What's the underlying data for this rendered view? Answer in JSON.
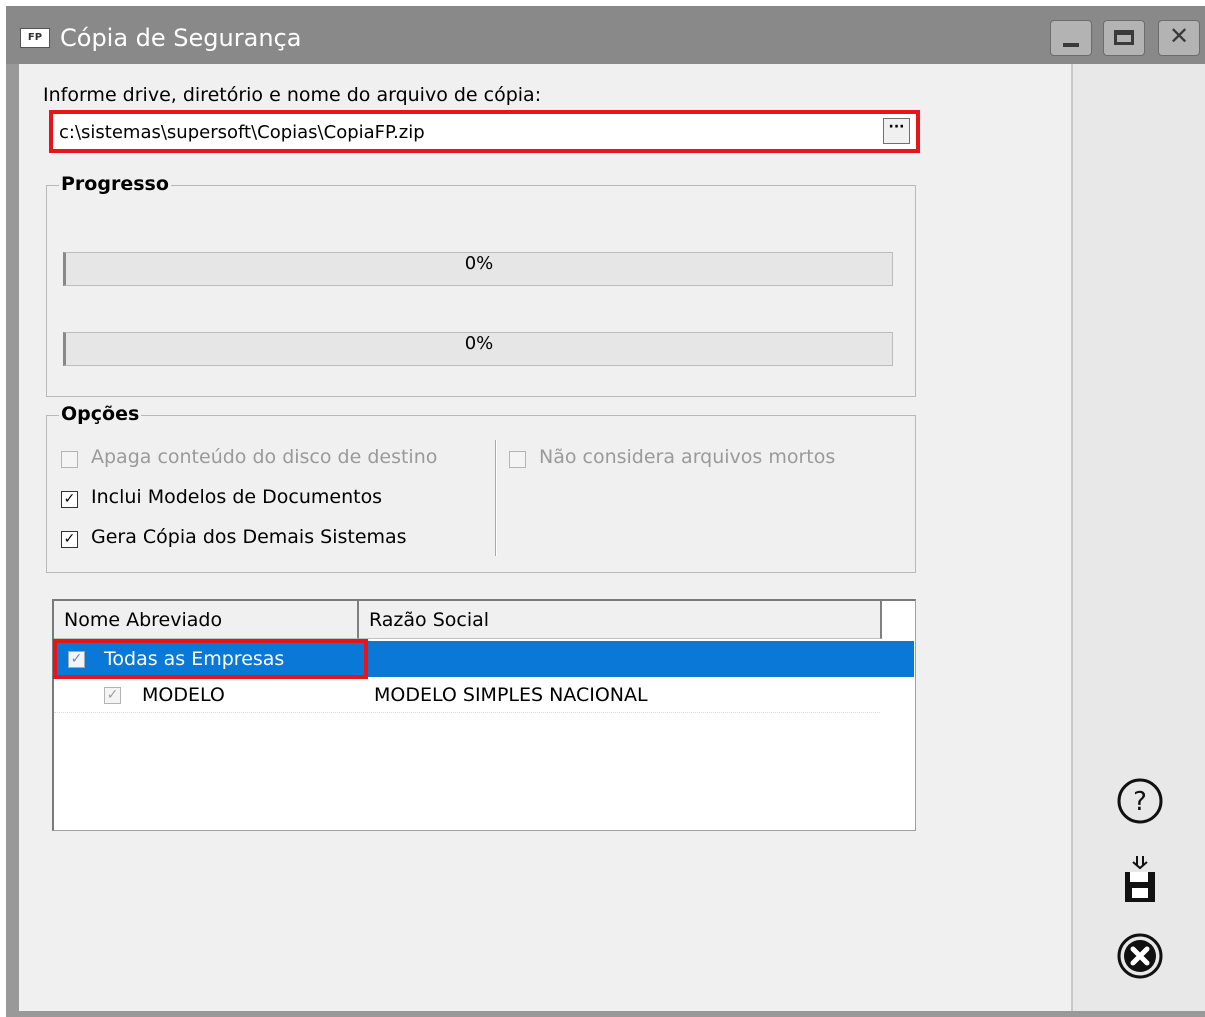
{
  "window": {
    "app_badge": "FP",
    "title": "Cópia de Segurança",
    "controls": {
      "minimize": "minimize-icon",
      "maximize": "maximize-icon",
      "close": "close-icon"
    }
  },
  "path": {
    "label": "Informe drive, diretório e nome do arquivo de cópia:",
    "value": "c:\\sistemas\\supersoft\\Copias\\CopiaFP.zip",
    "browse_label": "···"
  },
  "progress": {
    "title": "Progresso",
    "bars": [
      {
        "label": "0%",
        "value": 0
      },
      {
        "label": "0%",
        "value": 0
      }
    ]
  },
  "options": {
    "title": "Opções",
    "items": [
      {
        "label": "Apaga conteúdo do disco de destino",
        "checked": false,
        "enabled": false
      },
      {
        "label": "Inclui Modelos de Documentos",
        "checked": true,
        "enabled": true
      },
      {
        "label": "Gera Cópia dos Demais Sistemas",
        "checked": true,
        "enabled": true
      },
      {
        "label": "Não considera arquivos mortos",
        "checked": false,
        "enabled": false
      }
    ]
  },
  "companies": {
    "columns": [
      "Nome Abreviado",
      "Razão Social"
    ],
    "rows": [
      {
        "name": "Todas as Empresas",
        "razao": "",
        "checked": true,
        "selected": true
      },
      {
        "name": "MODELO",
        "razao": "MODELO SIMPLES NACIONAL",
        "checked": true,
        "selected": false
      }
    ]
  },
  "sidebar": {
    "help_icon": "help-icon",
    "save_icon": "save-icon",
    "cancel_icon": "cancel-icon"
  },
  "colors": {
    "highlight": "#e8141c",
    "selection": "#0a78d7",
    "titlebar": "#898989"
  }
}
